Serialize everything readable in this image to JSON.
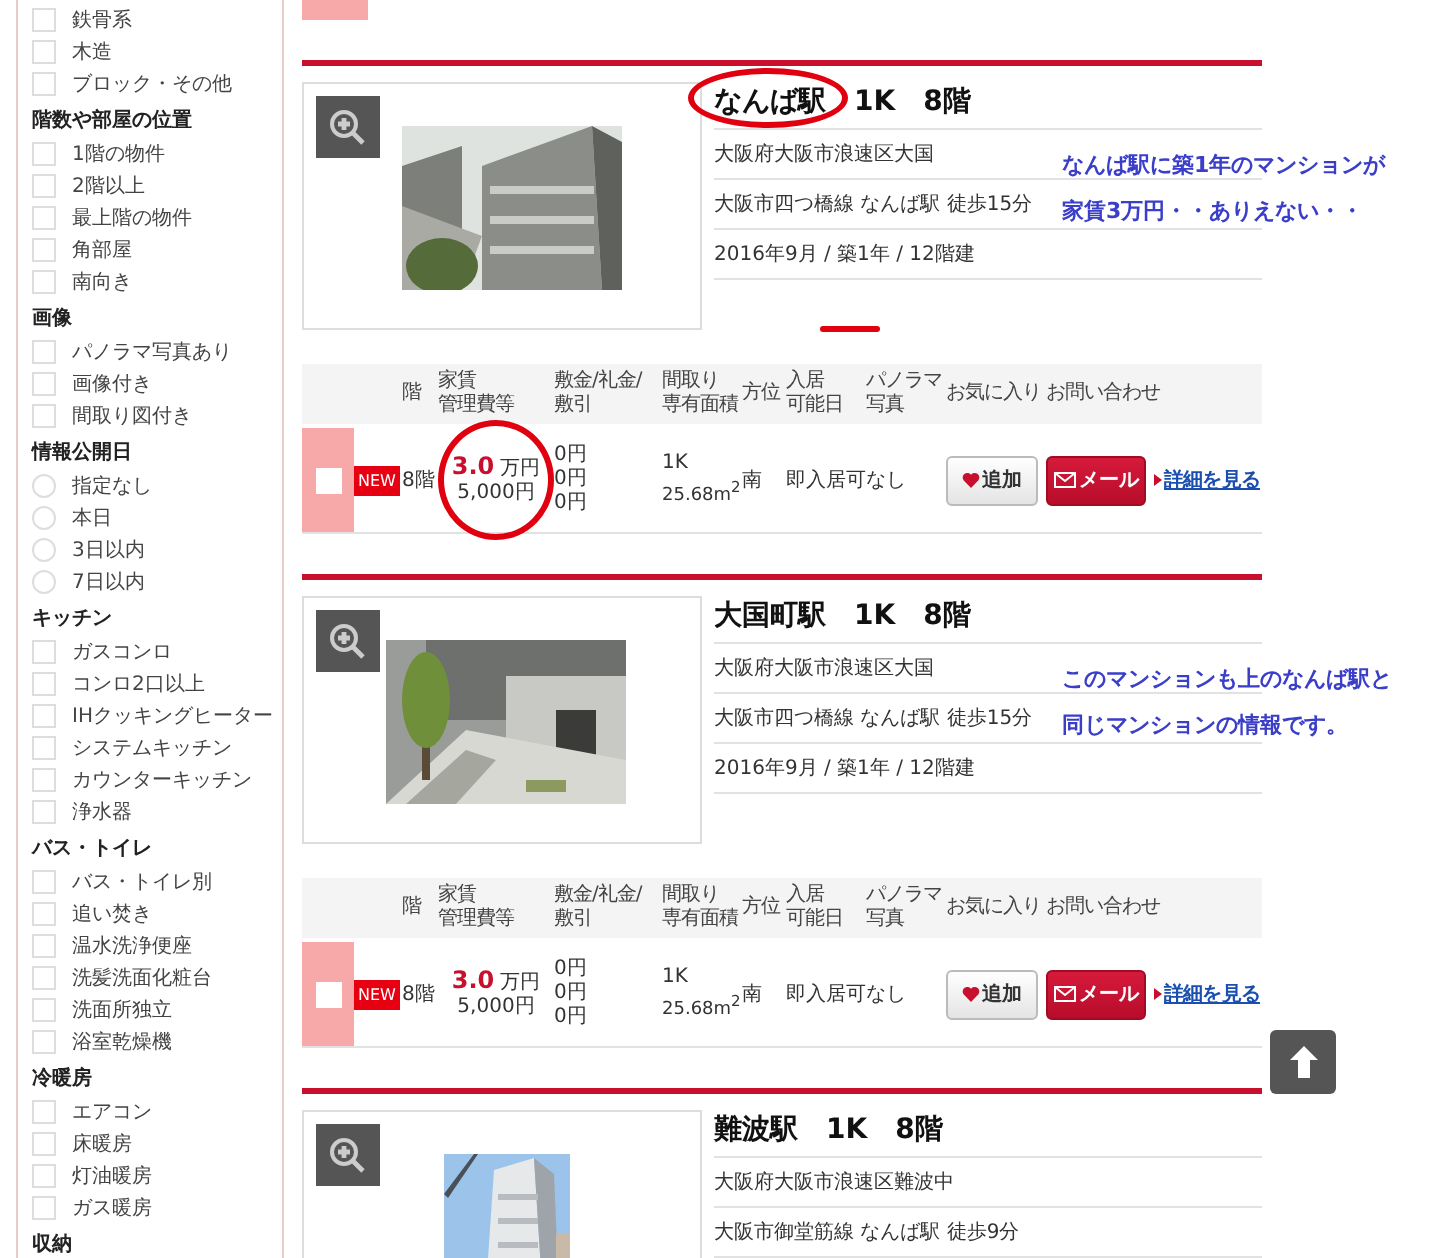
{
  "sidebar": {
    "groups": [
      {
        "kind": "checkbox",
        "items": [
          {
            "label": "鉄骨系",
            "checked": false
          },
          {
            "label": "木造",
            "checked": false
          },
          {
            "label": "ブロック・その他",
            "checked": false
          }
        ]
      },
      {
        "heading": "階数や部屋の位置",
        "kind": "checkbox",
        "items": [
          {
            "label": "1階の物件",
            "checked": false
          },
          {
            "label": "2階以上",
            "checked": false
          },
          {
            "label": "最上階の物件",
            "checked": false
          },
          {
            "label": "角部屋",
            "checked": false
          },
          {
            "label": "南向き",
            "checked": false
          }
        ]
      },
      {
        "heading": "画像",
        "kind": "checkbox",
        "items": [
          {
            "label": "パノラマ写真あり",
            "checked": false
          },
          {
            "label": "画像付き",
            "checked": false
          },
          {
            "label": "間取り図付き",
            "checked": false
          }
        ]
      },
      {
        "heading": "情報公開日",
        "kind": "radio",
        "items": [
          {
            "label": "指定なし",
            "checked": false
          },
          {
            "label": "本日",
            "checked": false
          },
          {
            "label": "3日以内",
            "checked": false
          },
          {
            "label": "7日以内",
            "checked": false
          }
        ]
      },
      {
        "heading": "キッチン",
        "kind": "checkbox",
        "items": [
          {
            "label": "ガスコンロ",
            "checked": false
          },
          {
            "label": "コンロ2口以上",
            "checked": false
          },
          {
            "label": "IHクッキングヒーター",
            "checked": false
          },
          {
            "label": "システムキッチン",
            "checked": false
          },
          {
            "label": "カウンターキッチン",
            "checked": false
          },
          {
            "label": "浄水器",
            "checked": false
          }
        ]
      },
      {
        "heading": "バス・トイレ",
        "kind": "checkbox",
        "items": [
          {
            "label": "バス・トイレ別",
            "checked": false
          },
          {
            "label": "追い焚き",
            "checked": false
          },
          {
            "label": "温水洗浄便座",
            "checked": false
          },
          {
            "label": "洗髪洗面化粧台",
            "checked": false
          },
          {
            "label": "洗面所独立",
            "checked": false
          },
          {
            "label": "浴室乾燥機",
            "checked": false
          }
        ]
      },
      {
        "heading": "冷暖房",
        "kind": "checkbox",
        "items": [
          {
            "label": "エアコン",
            "checked": false
          },
          {
            "label": "床暖房",
            "checked": false
          },
          {
            "label": "灯油暖房",
            "checked": false
          },
          {
            "label": "ガス暖房",
            "checked": false
          }
        ]
      },
      {
        "heading": "収納"
      }
    ]
  },
  "listings": [
    {
      "title": "なんば駅　1K　8階",
      "address": "大阪府大阪市浪速区大国",
      "access": "大阪市四つ橋線 なんば駅 徒歩15分",
      "built": "2016年9月 / 築1年 / 12階建",
      "photo": {
        "kind": "picture"
      },
      "table": {
        "columns": [
          [
            "階"
          ],
          [
            "家賃",
            "管理費等"
          ],
          [
            "敷金/礼金/",
            "敷引"
          ],
          [
            "間取り",
            "専有面積"
          ],
          [
            "方位"
          ],
          [
            "入居",
            "可能日"
          ],
          [
            "パノラマ",
            "写真"
          ],
          [
            "お気に入り"
          ],
          [
            "お問い合わせ"
          ]
        ],
        "row": {
          "checked": false,
          "badge": "NEW",
          "floor": "8階",
          "rent": "3.0",
          "rent_unit": "万円",
          "fee": "5,000円",
          "deposits": [
            "0円",
            "0円",
            "0円"
          ],
          "layout": "1K",
          "area": "25.68m$^{2}$",
          "direction": "南",
          "move_in": "即入居可",
          "panorama": "なし",
          "favorite_button": "追加",
          "contact_button": "メール",
          "details_link": "詳細を見る"
        }
      },
      "annotations": [
        {
          "kind": "title-circle"
        },
        {
          "kind": "age-underline"
        },
        {
          "kind": "rent-circle"
        },
        {
          "kind": "note",
          "lines": [
            "なんば駅に築1年のマンションが",
            "家賃3万円・・ありえない・・"
          ]
        }
      ]
    },
    {
      "title": "大国町駅　1K　8階",
      "address": "大阪府大阪市浪速区大国",
      "access": "大阪市四つ橋線 なんば駅 徒歩15分",
      "built": "2016年9月 / 築1年 / 12階建",
      "photo": {
        "kind": "picture"
      },
      "table": {
        "columns": [
          [
            "階"
          ],
          [
            "家賃",
            "管理費等"
          ],
          [
            "敷金/礼金/",
            "敷引"
          ],
          [
            "間取り",
            "専有面積"
          ],
          [
            "方位"
          ],
          [
            "入居",
            "可能日"
          ],
          [
            "パノラマ",
            "写真"
          ],
          [
            "お気に入り"
          ],
          [
            "お問い合わせ"
          ]
        ],
        "row": {
          "checked": false,
          "badge": "NEW",
          "floor": "8階",
          "rent": "3.0",
          "rent_unit": "万円",
          "fee": "5,000円",
          "deposits": [
            "0円",
            "0円",
            "0円"
          ],
          "layout": "1K",
          "area": "25.68m$^{2}$",
          "direction": "南",
          "move_in": "即入居可",
          "panorama": "なし",
          "favorite_button": "追加",
          "contact_button": "メール",
          "details_link": "詳細を見る"
        }
      },
      "annotations": [
        {
          "kind": "note",
          "lines": [
            "このマンションも上のなんば駅と",
            "同じマンションの情報です。"
          ]
        }
      ]
    },
    {
      "title": "難波駅　1K　8階",
      "address": "大阪府大阪市浪速区難波中",
      "access": "大阪市御堂筋線 なんば駅 徒歩9分",
      "photo": {
        "kind": "picture"
      }
    }
  ]
}
